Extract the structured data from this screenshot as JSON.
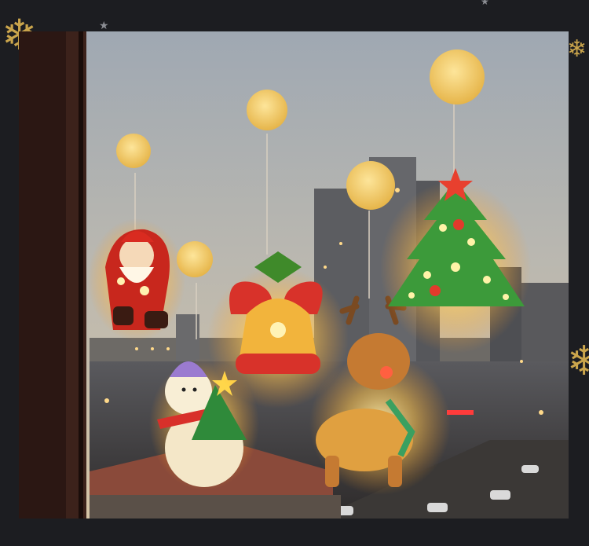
{
  "image": {
    "subject": "christmas-window-suction-lights",
    "lights": [
      {
        "kind": "santa",
        "icon": "santa-icon"
      },
      {
        "kind": "snowman",
        "icon": "snowman-icon"
      },
      {
        "kind": "bell",
        "icon": "bell-icon"
      },
      {
        "kind": "reindeer",
        "icon": "reindeer-icon"
      },
      {
        "kind": "christmas-tree",
        "icon": "christmas-tree-icon"
      }
    ],
    "colors": {
      "background": "#1c1d21",
      "ornament_gold": "#c9a24a",
      "suction_cup": "#f2c65a",
      "sky_top": "#a9b0b8",
      "sky_bottom": "#d7c7ad",
      "window_frame": "#2a1612"
    }
  },
  "decorations": {
    "snowflake_glyph": "❄",
    "star_glyph": "★"
  }
}
